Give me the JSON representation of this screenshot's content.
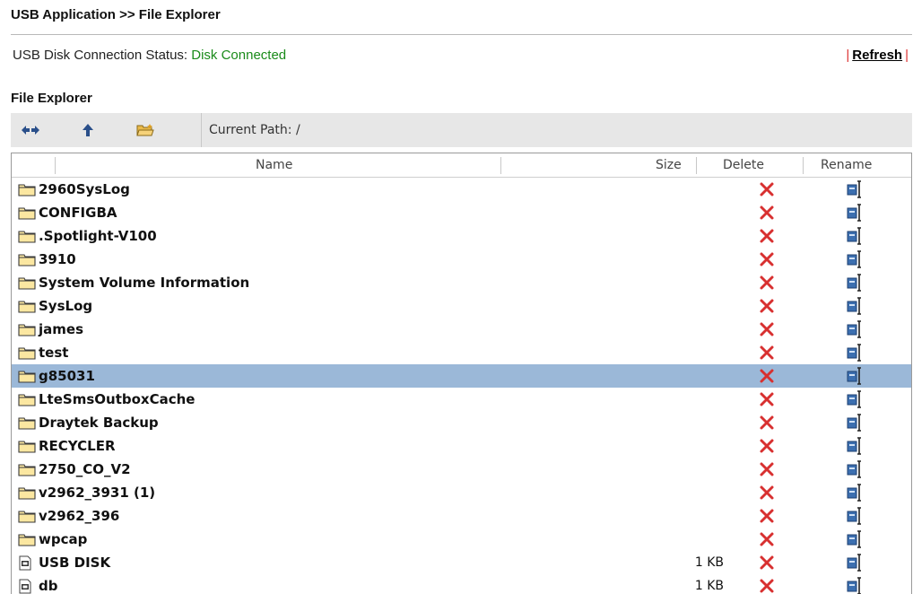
{
  "page": {
    "title": "USB Application >> File Explorer",
    "status_label": "USB Disk Connection Status: ",
    "status_value": "Disk Connected",
    "refresh_label": "Refresh",
    "section_title": "File Explorer"
  },
  "toolbar": {
    "buttons": [
      {
        "icon": "swap-arrows-icon"
      },
      {
        "icon": "up-arrow-icon"
      },
      {
        "icon": "new-folder-icon"
      }
    ],
    "current_path": "Current Path: /"
  },
  "list": {
    "columns": {
      "name": "Name",
      "size": "Size",
      "delete": "Delete",
      "rename": "Rename"
    },
    "selected": "g85031",
    "items": [
      {
        "name": "2960SysLog",
        "type": "folder",
        "size": ""
      },
      {
        "name": "CONFIGBA",
        "type": "folder",
        "size": ""
      },
      {
        "name": ".Spotlight-V100",
        "type": "folder",
        "size": ""
      },
      {
        "name": "3910",
        "type": "folder",
        "size": ""
      },
      {
        "name": "System Volume Information",
        "type": "folder",
        "size": ""
      },
      {
        "name": "SysLog",
        "type": "folder",
        "size": ""
      },
      {
        "name": "james",
        "type": "folder",
        "size": ""
      },
      {
        "name": "test",
        "type": "folder",
        "size": ""
      },
      {
        "name": "g85031",
        "type": "folder",
        "size": ""
      },
      {
        "name": "LteSmsOutboxCache",
        "type": "folder",
        "size": ""
      },
      {
        "name": "Draytek Backup",
        "type": "folder",
        "size": ""
      },
      {
        "name": "RECYCLER",
        "type": "folder",
        "size": ""
      },
      {
        "name": "2750_CO_V2",
        "type": "folder",
        "size": ""
      },
      {
        "name": "v2962_3931 (1)",
        "type": "folder",
        "size": ""
      },
      {
        "name": "v2962_396",
        "type": "folder",
        "size": ""
      },
      {
        "name": "wpcap",
        "type": "folder",
        "size": ""
      },
      {
        "name": "USB DISK",
        "type": "file",
        "size": "1 KB"
      },
      {
        "name": "db",
        "type": "file",
        "size": "1 KB"
      }
    ]
  },
  "colors": {
    "status_ok": "#1a8b1a",
    "selected_row": "#9bb8d8",
    "delete_x": "#d83030",
    "toolbar_bg": "#e7e7e7"
  }
}
